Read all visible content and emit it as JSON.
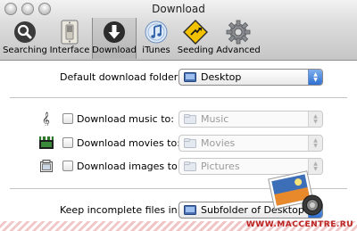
{
  "window": {
    "title": "Download"
  },
  "toolbar": {
    "items": [
      {
        "label": "Searching",
        "icon": "magnifier-icon"
      },
      {
        "label": "Interface",
        "icon": "switch-icon"
      },
      {
        "label": "Download",
        "icon": "download-arrow-icon",
        "selected": true
      },
      {
        "label": "iTunes",
        "icon": "itunes-icon"
      },
      {
        "label": "Seeding",
        "icon": "seeding-sign-icon"
      },
      {
        "label": "Advanced",
        "icon": "gear-icon"
      }
    ]
  },
  "download": {
    "default_folder_label": "Default download folder:",
    "default_folder_value": "Desktop",
    "music_label": "Download music to:",
    "music_value": "Music",
    "music_checked": false,
    "movies_label": "Download movies to:",
    "movies_value": "Movies",
    "movies_checked": false,
    "images_label": "Download images to:",
    "images_value": "Pictures",
    "images_checked": false,
    "incomplete_label": "Keep incomplete files in:",
    "incomplete_value": "Subfolder of Desktop"
  },
  "watermark": {
    "text": "WWW.MACCENTRE.RU"
  },
  "colors": {
    "accent": "#2f6fd0",
    "toolbar_top": "#f2f2f2",
    "toolbar_bottom": "#c6c6c6",
    "watermark": "#b22222"
  }
}
